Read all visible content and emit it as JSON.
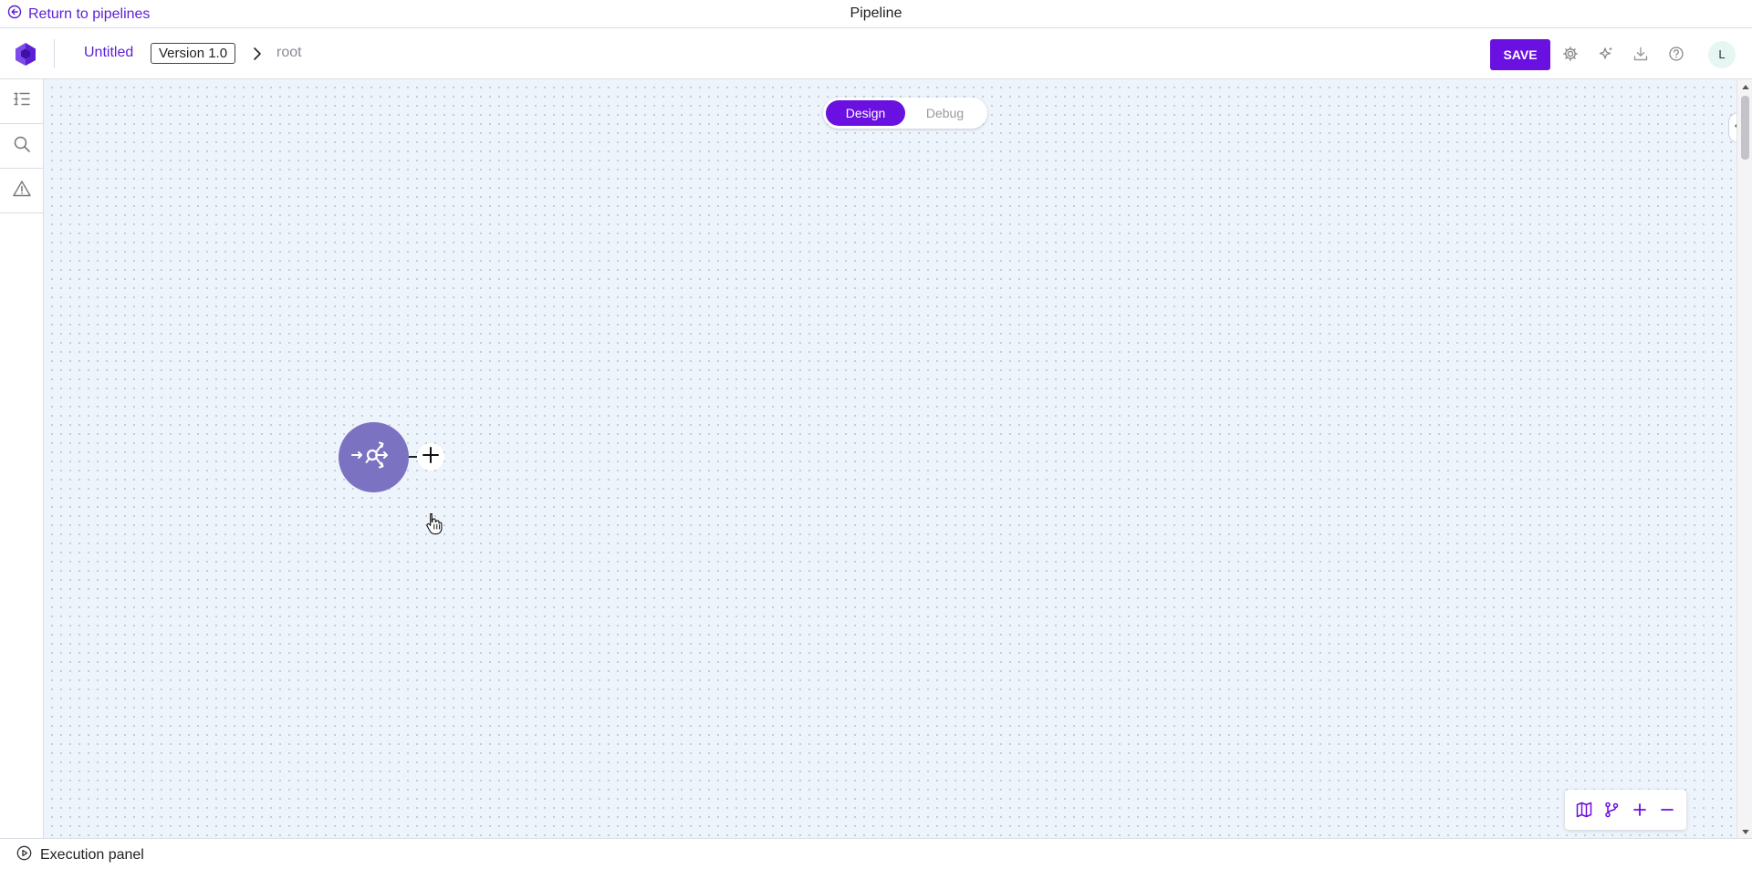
{
  "topbar": {
    "return_label": "Return to pipelines",
    "title": "Pipeline"
  },
  "header": {
    "pipeline_name": "Untitled",
    "version": "Version 1.0",
    "breadcrumb_root": "root",
    "save_label": "SAVE",
    "avatar_initial": "L",
    "icons": [
      "settings-icon",
      "ai-sparkle-icon",
      "download-icon",
      "help-icon"
    ]
  },
  "left_rail": {
    "items": [
      "outline-icon",
      "search-icon",
      "warning-icon"
    ]
  },
  "canvas": {
    "modes": [
      "Design",
      "Debug"
    ],
    "active_mode": "Design",
    "node_icon": "router-node-icon",
    "zoom_controls": [
      "map-icon",
      "branch-icon",
      "zoom-in-icon",
      "zoom-out-icon"
    ]
  },
  "bottombar": {
    "execution_label": "Execution panel"
  },
  "colors": {
    "accent": "#6a10e0",
    "link": "#5b1fd6",
    "node": "#7b73c2",
    "canvas_bg": "#eef4fb"
  }
}
